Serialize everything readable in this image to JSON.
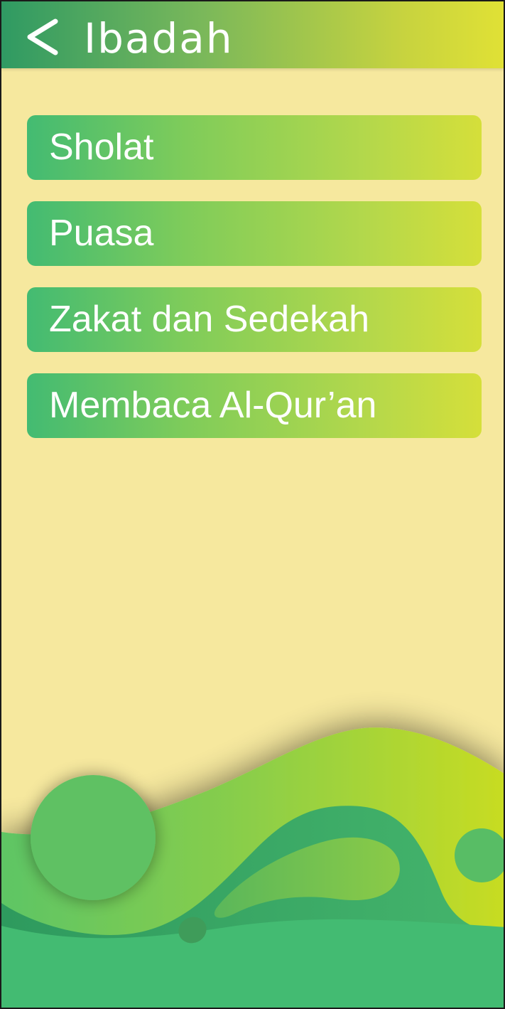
{
  "header": {
    "back_icon": "chevron-left-icon",
    "title": "Ibadah"
  },
  "menu": {
    "items": [
      {
        "label": "Sholat"
      },
      {
        "label": "Puasa"
      },
      {
        "label": "Zakat dan Sedekah"
      },
      {
        "label": "Membaca Al-Qur’an"
      }
    ]
  },
  "colors": {
    "background": "#f6e89e",
    "header_start": "#2f9a63",
    "header_end": "#e0e135",
    "item_start": "#43bb72",
    "item_end": "#d5df3a",
    "text": "#ffffff"
  }
}
